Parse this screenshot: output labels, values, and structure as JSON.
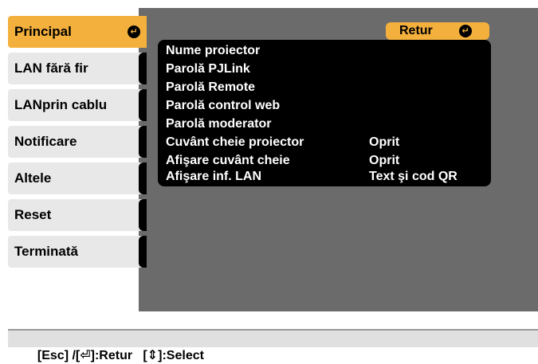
{
  "sidebar": {
    "items": [
      {
        "label": "Principal",
        "active": true
      },
      {
        "label": "LAN fără fir",
        "active": false
      },
      {
        "label": "LANprin cablu",
        "active": false
      },
      {
        "label": "Notificare",
        "active": false
      },
      {
        "label": "Altele",
        "active": false
      },
      {
        "label": "Reset",
        "active": false
      },
      {
        "label": "Terminată",
        "active": false
      }
    ]
  },
  "main": {
    "return_label": "Retur",
    "menu": [
      {
        "label": "Nume proiector",
        "value": ""
      },
      {
        "label": "Parolă PJLink",
        "value": ""
      },
      {
        "label": "Parolă Remote",
        "value": ""
      },
      {
        "label": "Parolă control web",
        "value": ""
      },
      {
        "label": "Parolă moderator",
        "value": ""
      },
      {
        "label": "Cuvânt cheie proiector",
        "value": "Oprit"
      },
      {
        "label": "Afişare cuvânt cheie",
        "value": "Oprit"
      },
      {
        "label": "Afişare inf. LAN",
        "value": "Text şi cod QR"
      }
    ]
  },
  "status_bar": {
    "text": "[Esc] /[⏎]:Retur   [⇕]:Select"
  },
  "icons": {
    "enter": "enter-icon",
    "retur": "enter-icon"
  },
  "colors": {
    "accent": "#f4b03c",
    "panel": "#6b6b6b",
    "menu_bg": "#000000",
    "sidebar_bg": "#e8e8e8"
  }
}
